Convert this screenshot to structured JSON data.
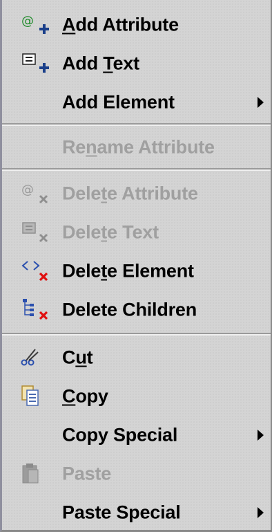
{
  "menu": {
    "items": [
      {
        "label": "Add Attribute",
        "mnemonic": "A",
        "icon": "attribute-add-icon",
        "enabled": true,
        "submenu": false
      },
      {
        "label": "Add Text",
        "mnemonic": "T",
        "icon": "text-add-icon",
        "enabled": true,
        "submenu": false
      },
      {
        "label": "Add Element",
        "mnemonic": "",
        "icon": "",
        "enabled": true,
        "submenu": true
      },
      {
        "label": "Rename Attribute",
        "mnemonic": "n",
        "icon": "",
        "enabled": false,
        "submenu": false
      },
      {
        "label": "Delete Attribute",
        "mnemonic": "t",
        "icon": "attribute-delete-icon",
        "enabled": false,
        "submenu": false
      },
      {
        "label": "Delete Text",
        "mnemonic": "t",
        "icon": "text-delete-icon",
        "enabled": false,
        "submenu": false
      },
      {
        "label": "Delete Element",
        "mnemonic": "t",
        "icon": "element-delete-icon",
        "enabled": true,
        "submenu": false
      },
      {
        "label": "Delete Children",
        "mnemonic": "",
        "icon": "children-delete-icon",
        "enabled": true,
        "submenu": false
      },
      {
        "label": "Cut",
        "mnemonic": "u",
        "icon": "scissors-icon",
        "enabled": true,
        "submenu": false
      },
      {
        "label": "Copy",
        "mnemonic": "C",
        "icon": "copy-icon",
        "enabled": true,
        "submenu": false
      },
      {
        "label": "Copy Special",
        "mnemonic": "",
        "icon": "",
        "enabled": true,
        "submenu": true
      },
      {
        "label": "Paste",
        "mnemonic": "",
        "icon": "paste-icon",
        "enabled": false,
        "submenu": false
      },
      {
        "label": "Paste Special",
        "mnemonic": "",
        "icon": "",
        "enabled": true,
        "submenu": true
      }
    ]
  },
  "colors": {
    "background": "#d4d4d4",
    "disabled_text": "#a0a0a0",
    "add_plus": "#1a3f8a",
    "delete_x_enabled": "#e01010",
    "delete_x_disabled": "#8f8f8f"
  }
}
